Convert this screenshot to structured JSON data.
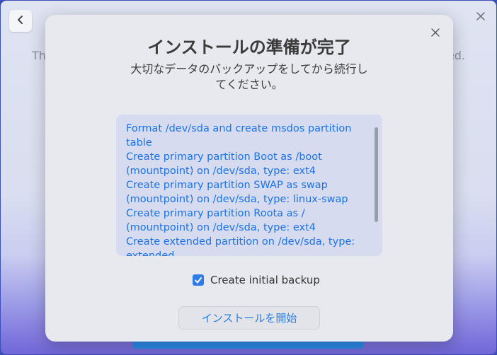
{
  "background": {
    "text_left": "Th",
    "text_right": "ed."
  },
  "dialog": {
    "title": "インストールの準備が完了",
    "subtitle": "大切なデータのバックアップをしてから続行してください。",
    "operations": [
      "Format /dev/sda and create msdos partition table",
      "Create primary partition Boot as /boot (mountpoint) on /dev/sda, type: ext4",
      "Create primary partition SWAP as swap (mountpoint) on /dev/sda, type: linux-swap",
      "Create primary partition Roota as / (mountpoint) on /dev/sda, type: ext4",
      "Create extended partition  on /dev/sda, type: extended"
    ],
    "backup_checkbox": {
      "label": "Create initial backup",
      "checked": true
    },
    "install_button": "インストールを開始"
  },
  "icons": {
    "back": "chevron-left-icon",
    "window_close": "close-icon",
    "dialog_close": "close-icon",
    "check": "checkmark-icon"
  },
  "colors": {
    "accent": "#1a73e8",
    "checkbox": "#2e7be8",
    "dialog_bg": "#e8e9ee",
    "list_bg": "#d7dbef"
  }
}
